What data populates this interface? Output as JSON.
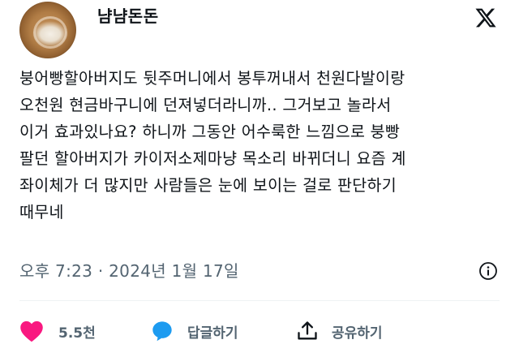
{
  "author": {
    "display_name": "냠냠돈돈"
  },
  "platform_logo": "x-logo-icon",
  "tweet": {
    "lines": [
      "붕어빵할아버지도 뒷주머니에서 봉투꺼내서 천원다발이랑",
      "오천원 현금바구니에 던져넣더라니까.. 그거보고 놀라서",
      "이거 효과있나요? 하니까 그동안 어수룩한 느낌으로 붕빵",
      "팔던 할아버지가 카이저소제마냥 목소리 바뀌더니 요즘 계",
      "좌이체가 더 많지만 사람들은 눈에 보이는 걸로 판단하기",
      "때무네"
    ]
  },
  "meta": {
    "timestamp": "오후 7:23 · 2024년 1월 17일"
  },
  "actions": {
    "like_count": "5.5천",
    "reply_label": "답글하기",
    "share_label": "공유하기"
  },
  "colors": {
    "like": "#f91880",
    "reply": "#1d9bf0",
    "muted": "#536471",
    "text": "#0f1419"
  }
}
